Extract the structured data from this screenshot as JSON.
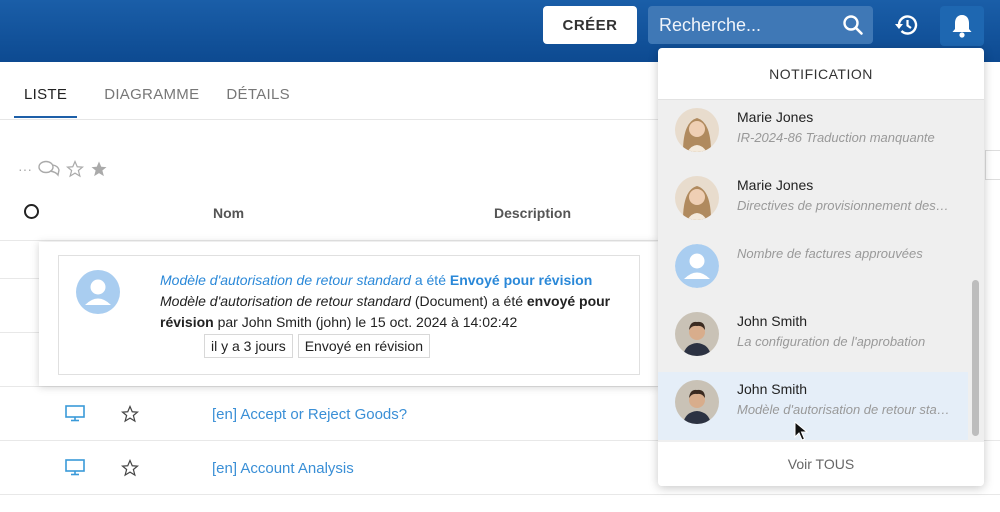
{
  "header": {
    "create_label": "CRÉER",
    "search_placeholder": "Recherche...",
    "accent_color": "#0d4a91"
  },
  "tabs": [
    {
      "label": "LISTE",
      "active": true
    },
    {
      "label": "DIAGRAMME",
      "active": false
    },
    {
      "label": "DÉTAILS",
      "active": false
    }
  ],
  "table": {
    "columns": [
      "Nom",
      "Description"
    ],
    "rows": [
      {
        "name": "[en] Accept or Reject Goods?",
        "icon": "monitor-icon"
      },
      {
        "name": "[en] Account Analysis",
        "icon": "monitor-icon"
      }
    ]
  },
  "popup": {
    "title_italic": "Modèle d'autorisation de retour standard",
    "title_mid": " a été ",
    "title_status": "Envoyé pour révision",
    "body_italic": "Modèle d'autorisation de retour standard",
    "body_mid": " (Document) a été ",
    "body_bold": "envoyé pour révision",
    "body_tail": " par John Smith (john) le 15 oct. 2024 à 14:02:42",
    "chip_time": "il y a 3 jours",
    "chip_status": "Envoyé en révision"
  },
  "notifications": {
    "title": "NOTIFICATION",
    "see_all": "Voir TOUS",
    "items": [
      {
        "name": "Marie Jones",
        "message": "IR-2024-86 Traduction manquante",
        "avatar": "woman-photo"
      },
      {
        "name": "Marie Jones",
        "message": "Directives de provisionnement des comptes",
        "avatar": "woman-photo"
      },
      {
        "name": "",
        "message": "Nombre de factures approuvées",
        "avatar": "default-avatar"
      },
      {
        "name": "John Smith",
        "message": "La configuration de l'approbation",
        "avatar": "man-photo"
      },
      {
        "name": "John Smith",
        "message": "Modèle d'autorisation de retour standard",
        "avatar": "man-photo",
        "highlighted": true
      }
    ]
  }
}
